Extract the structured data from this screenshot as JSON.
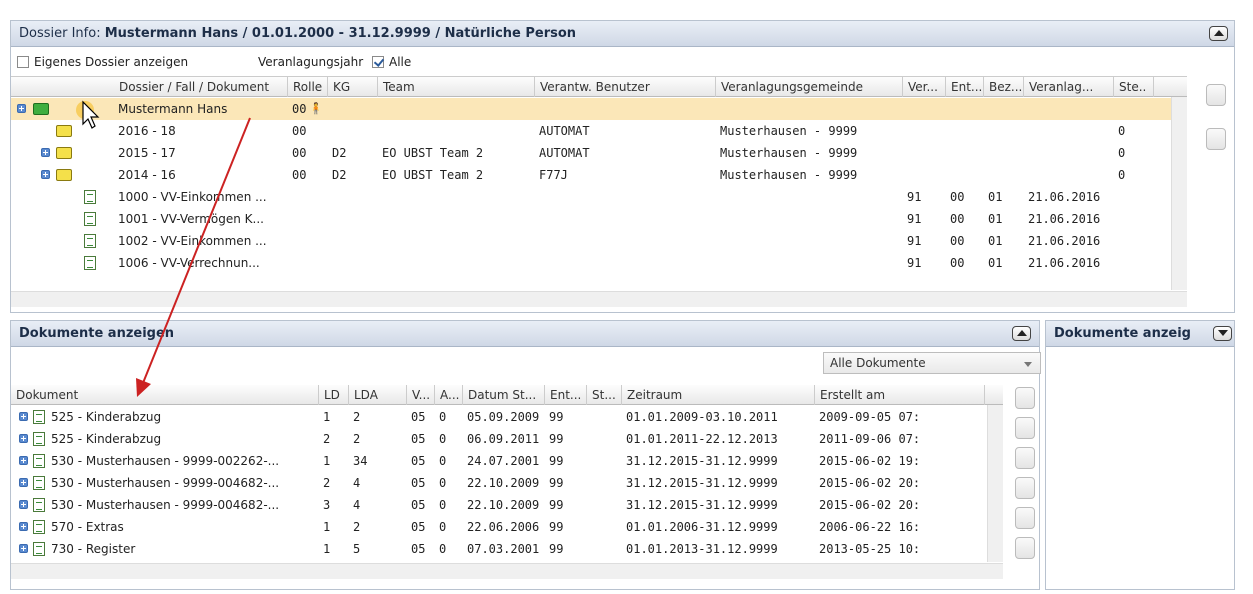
{
  "dossier": {
    "label": "Dossier Info:",
    "title": "Mustermann Hans / 01.01.2000 - 31.12.9999 / Natürliche Person",
    "own_dossier_label": "Eigenes Dossier anzeigen",
    "year_label": "Veranlagungsjahr",
    "all_label": "Alle",
    "columns": [
      "Dossier / Fall / Dokument",
      "Rolle",
      "KG",
      "Team",
      "Verantw. Benutzer",
      "Veranlagungsgemeinde",
      "Ver...",
      "Ent...",
      "Bez...",
      "Veranlag...",
      "Ste.."
    ],
    "rows": [
      {
        "name": "Mustermann Hans",
        "rolle": "00",
        "kg": "",
        "team": "",
        "user": "",
        "gemeinde": "",
        "ver": "",
        "ent": "",
        "bez": "",
        "veranlag": "",
        "ste": ""
      },
      {
        "name": "2016 - 18",
        "rolle": "00",
        "kg": "",
        "team": "",
        "user": "AUTOMAT",
        "gemeinde": "Musterhausen - 9999",
        "ver": "",
        "ent": "",
        "bez": "",
        "veranlag": "",
        "ste": "0"
      },
      {
        "name": "2015 - 17",
        "rolle": "00",
        "kg": "D2",
        "team": "EO UBST Team 2",
        "user": "AUTOMAT",
        "gemeinde": "Musterhausen - 9999",
        "ver": "",
        "ent": "",
        "bez": "",
        "veranlag": "",
        "ste": "0"
      },
      {
        "name": "2014 - 16",
        "rolle": "00",
        "kg": "D2",
        "team": "EO UBST Team 2",
        "user": "F77J",
        "gemeinde": "Musterhausen - 9999",
        "ver": "",
        "ent": "",
        "bez": "",
        "veranlag": "",
        "ste": "0"
      },
      {
        "name": "1000 - VV-Einkommen ...",
        "rolle": "",
        "kg": "",
        "team": "",
        "user": "",
        "gemeinde": "",
        "ver": "91",
        "ent": "00",
        "bez": "01",
        "veranlag": "21.06.2016",
        "ste": ""
      },
      {
        "name": "1001 - VV-Vermögen K...",
        "rolle": "",
        "kg": "",
        "team": "",
        "user": "",
        "gemeinde": "",
        "ver": "91",
        "ent": "00",
        "bez": "01",
        "veranlag": "21.06.2016",
        "ste": ""
      },
      {
        "name": "1002 - VV-Einkommen ...",
        "rolle": "",
        "kg": "",
        "team": "",
        "user": "",
        "gemeinde": "",
        "ver": "91",
        "ent": "00",
        "bez": "01",
        "veranlag": "21.06.2016",
        "ste": ""
      },
      {
        "name": "1006 - VV-Verrechnun...",
        "rolle": "",
        "kg": "",
        "team": "",
        "user": "",
        "gemeinde": "",
        "ver": "91",
        "ent": "00",
        "bez": "01",
        "veranlag": "21.06.2016",
        "ste": ""
      }
    ]
  },
  "documents": {
    "title": "Dokumente anzeigen",
    "filter": "Alle Dokumente",
    "columns": [
      "Dokument",
      "LD",
      "LDA",
      "V...",
      "A...",
      "Datum St...",
      "Ent...",
      "St...",
      "Zeitraum",
      "Erstellt am"
    ],
    "rows": [
      {
        "doc": "525 - Kinderabzug",
        "ld": "1",
        "lda": "2",
        "v": "05",
        "a": "0",
        "datum": "05.09.2009",
        "ent": "99",
        "st": "",
        "zeitraum": "01.01.2009-03.10.2011",
        "erstellt": "2009-09-05 07:"
      },
      {
        "doc": "525 - Kinderabzug",
        "ld": "2",
        "lda": "2",
        "v": "05",
        "a": "0",
        "datum": "06.09.2011",
        "ent": "99",
        "st": "",
        "zeitraum": "01.01.2011-22.12.2013",
        "erstellt": "2011-09-06 07:"
      },
      {
        "doc": "530 - Musterhausen - 9999-002262-...",
        "ld": "1",
        "lda": "34",
        "v": "05",
        "a": "0",
        "datum": "24.07.2001",
        "ent": "99",
        "st": "",
        "zeitraum": "31.12.2015-31.12.9999",
        "erstellt": "2015-06-02 19:"
      },
      {
        "doc": "530 - Musterhausen - 9999-004682-...",
        "ld": "2",
        "lda": "4",
        "v": "05",
        "a": "0",
        "datum": "22.10.2009",
        "ent": "99",
        "st": "",
        "zeitraum": "31.12.2015-31.12.9999",
        "erstellt": "2015-06-02 20:"
      },
      {
        "doc": "530 - Musterhausen - 9999-004682-...",
        "ld": "3",
        "lda": "4",
        "v": "05",
        "a": "0",
        "datum": "22.10.2009",
        "ent": "99",
        "st": "",
        "zeitraum": "31.12.2015-31.12.9999",
        "erstellt": "2015-06-02 20:"
      },
      {
        "doc": "570 - Extras",
        "ld": "1",
        "lda": "2",
        "v": "05",
        "a": "0",
        "datum": "22.06.2006",
        "ent": "99",
        "st": "",
        "zeitraum": "01.01.2006-31.12.9999",
        "erstellt": "2006-06-22 16:"
      },
      {
        "doc": "730 - Register",
        "ld": "1",
        "lda": "5",
        "v": "05",
        "a": "0",
        "datum": "07.03.2001",
        "ent": "99",
        "st": "",
        "zeitraum": "01.01.2013-31.12.9999",
        "erstellt": "2013-05-25 10:"
      }
    ]
  },
  "right_panel": {
    "title": "Dokumente anzeig"
  },
  "colors": {
    "highlight": "#fbe7b8",
    "header": "#cfd8e6",
    "arrow": "#cc2222"
  }
}
